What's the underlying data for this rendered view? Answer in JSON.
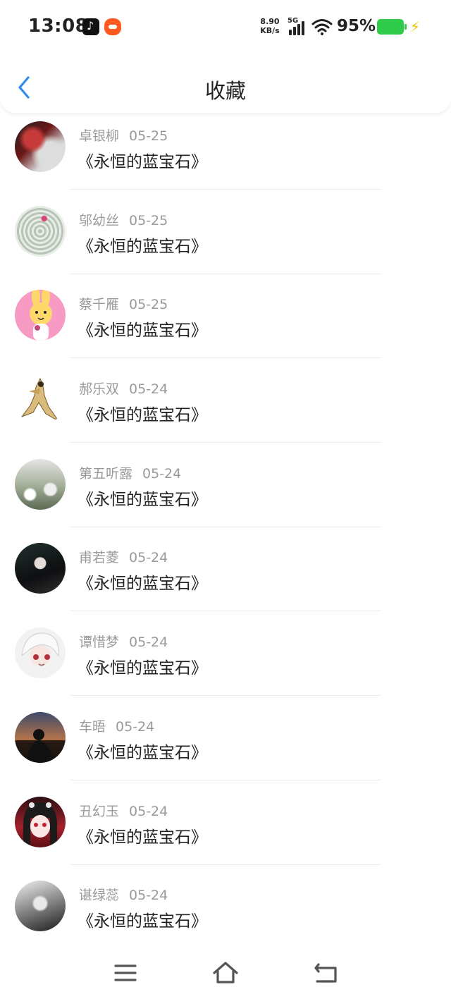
{
  "status_bar": {
    "time": "13:08",
    "net_speed_value": "8.90",
    "net_speed_unit": "KB/s",
    "network_type": "5G",
    "battery_percent": "95%",
    "battery_level": 0.95,
    "battery_color": "#2ecc4a",
    "icons": [
      "tiktok-icon",
      "taobao-icon",
      "signal-icon",
      "wifi-icon",
      "battery-icon",
      "charging-icon"
    ]
  },
  "header": {
    "title": "收藏",
    "back_icon": "chevron-left-icon",
    "accent_color": "#2d8cf0"
  },
  "favorites": [
    {
      "user": "卓银柳",
      "date": "05-25",
      "title": "《永恒的蓝宝石》"
    },
    {
      "user": "邬幼丝",
      "date": "05-25",
      "title": "《永恒的蓝宝石》"
    },
    {
      "user": "蔡千雁",
      "date": "05-25",
      "title": "《永恒的蓝宝石》"
    },
    {
      "user": "郝乐双",
      "date": "05-24",
      "title": "《永恒的蓝宝石》"
    },
    {
      "user": "第五听露",
      "date": "05-24",
      "title": "《永恒的蓝宝石》"
    },
    {
      "user": "甫若菱",
      "date": "05-24",
      "title": "《永恒的蓝宝石》"
    },
    {
      "user": "谭惜梦",
      "date": "05-24",
      "title": "《永恒的蓝宝石》"
    },
    {
      "user": "车晤",
      "date": "05-24",
      "title": "《永恒的蓝宝石》"
    },
    {
      "user": "丑幻玉",
      "date": "05-24",
      "title": "《永恒的蓝宝石》"
    },
    {
      "user": "谌绿蕊",
      "date": "05-24",
      "title": "《永恒的蓝宝石》"
    }
  ],
  "bottom_nav": {
    "icons": [
      "menu-icon",
      "home-icon",
      "back-icon"
    ]
  }
}
